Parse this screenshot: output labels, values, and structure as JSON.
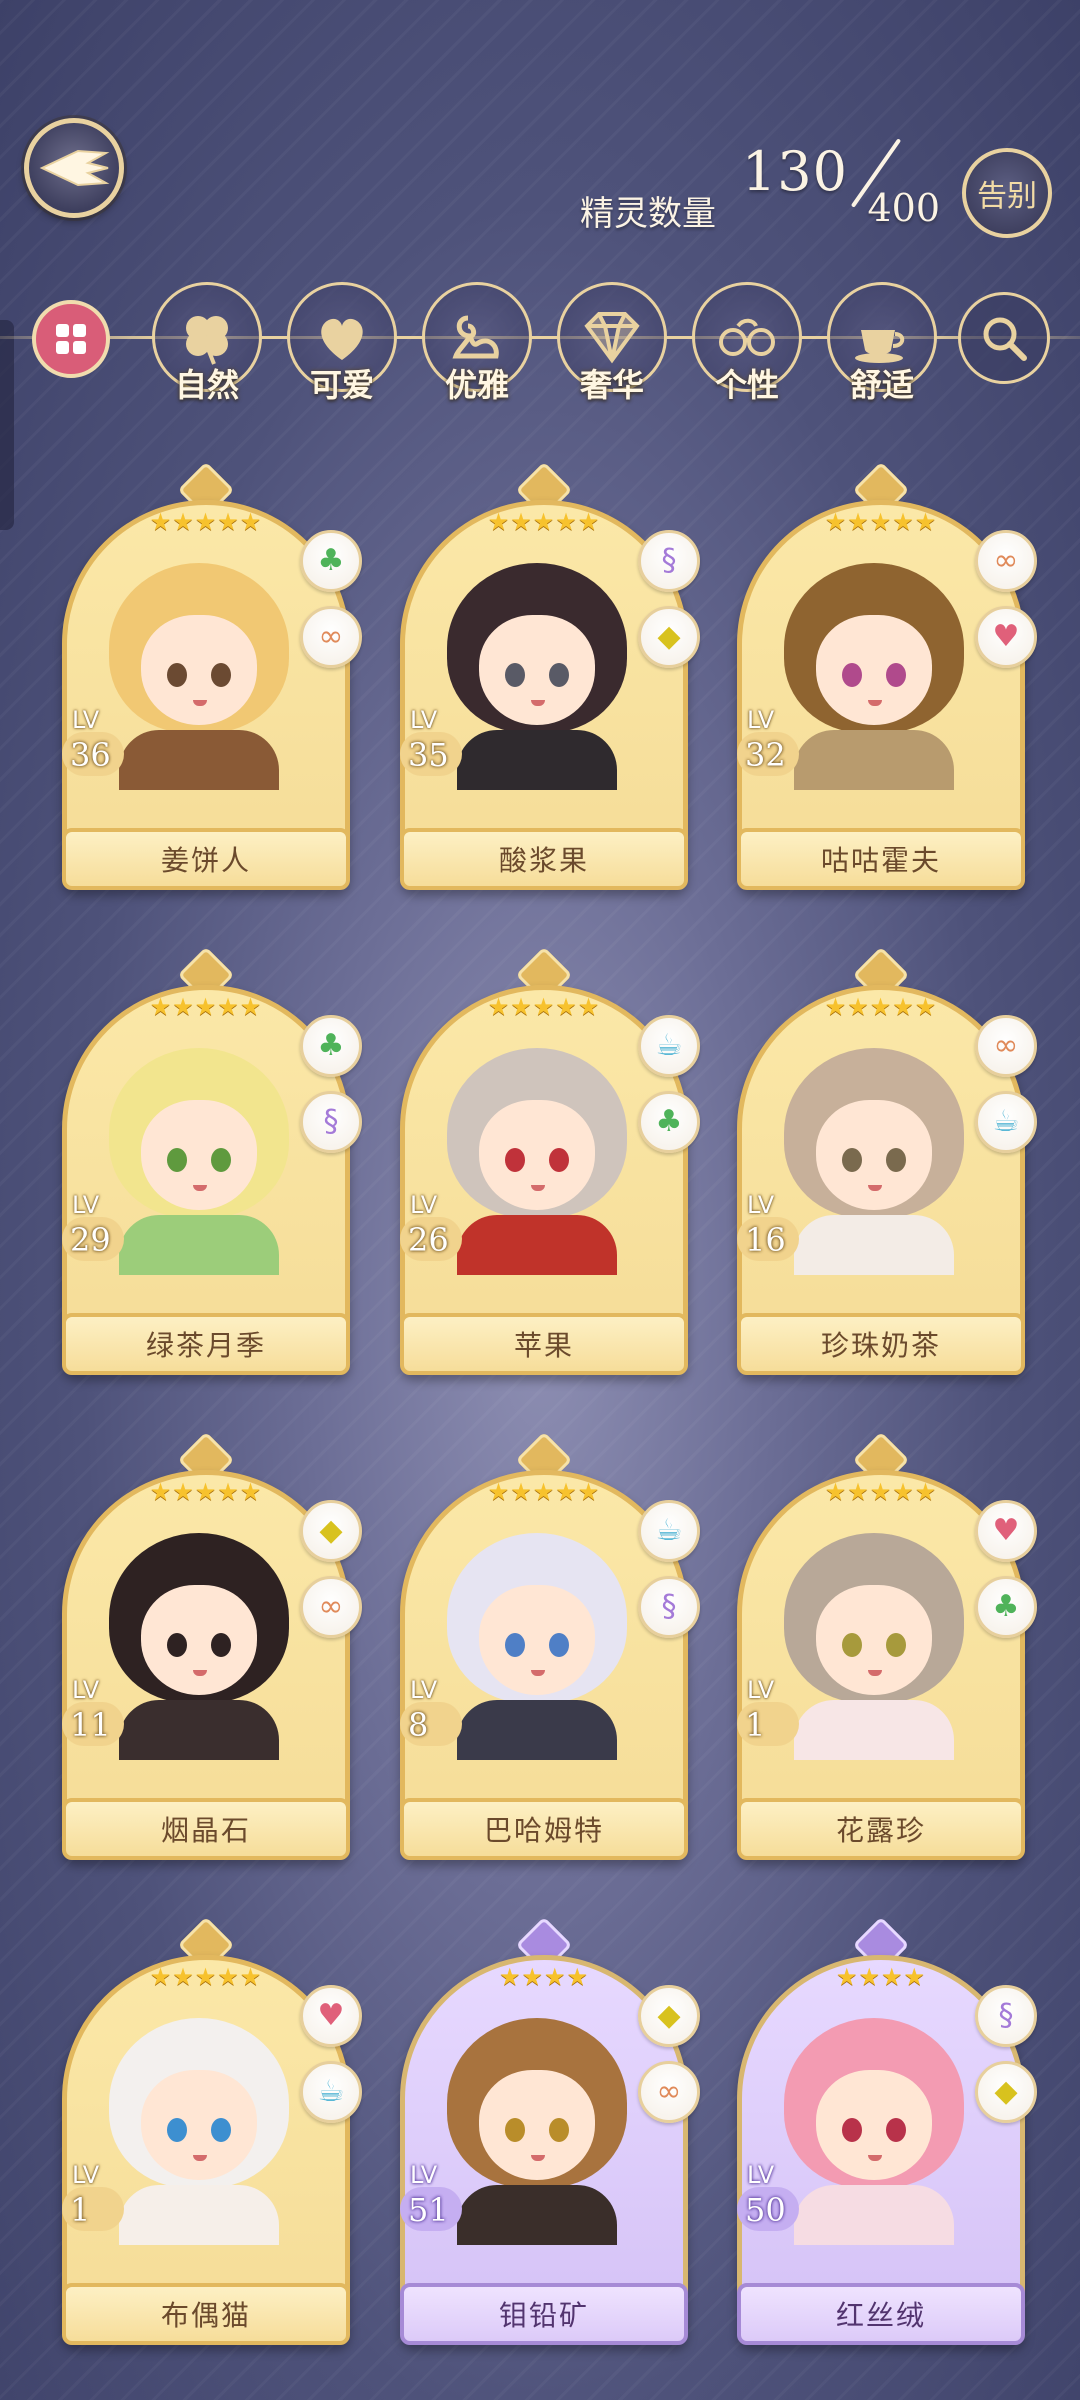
{
  "header": {
    "spirit_count_label": "精灵数量",
    "spirit_count_current": "130",
    "spirit_count_max": "400",
    "farewell_label": "告别"
  },
  "filters": [
    {
      "label": "自然",
      "icon": "clover-icon"
    },
    {
      "label": "可爱",
      "icon": "heart-icon"
    },
    {
      "label": "优雅",
      "icon": "swan-icon"
    },
    {
      "label": "奢华",
      "icon": "diamond-icon"
    },
    {
      "label": "个性",
      "icon": "glasses-icon"
    },
    {
      "label": "舒适",
      "icon": "teacup-icon"
    }
  ],
  "cards": [
    {
      "name": "姜饼人",
      "level_label": "LV",
      "level": "36",
      "stars": "★★★★★",
      "badges": [
        "clover-icon",
        "glasses-icon"
      ],
      "rarity": "gold",
      "hair": "#f1c873",
      "eye": "#6b4a32",
      "outfit": "#8a5a36"
    },
    {
      "name": "酸浆果",
      "level_label": "LV",
      "level": "35",
      "stars": "★★★★★",
      "badges": [
        "swan-icon",
        "diamond-icon"
      ],
      "rarity": "gold",
      "hair": "#3a2a2e",
      "eye": "#595a66",
      "outfit": "#2f2a2e"
    },
    {
      "name": "咕咕霍夫",
      "level_label": "LV",
      "level": "32",
      "stars": "★★★★★",
      "badges": [
        "glasses-icon",
        "heart-icon"
      ],
      "rarity": "gold",
      "hair": "#8f6430",
      "eye": "#b04a8c",
      "outfit": "#b89b6e"
    },
    {
      "name": "绿茶月季",
      "level_label": "LV",
      "level": "29",
      "stars": "★★★★★",
      "badges": [
        "clover-icon",
        "swan-icon"
      ],
      "rarity": "gold",
      "hair": "#f2e58e",
      "eye": "#5f9a3e",
      "outfit": "#9ccd7a"
    },
    {
      "name": "苹果",
      "level_label": "LV",
      "level": "26",
      "stars": "★★★★★",
      "badges": [
        "teacup-icon",
        "clover-icon"
      ],
      "rarity": "gold",
      "hair": "#cfc4bc",
      "eye": "#c0323a",
      "outfit": "#c0332a"
    },
    {
      "name": "珍珠奶茶",
      "level_label": "LV",
      "level": "16",
      "stars": "★★★★★",
      "badges": [
        "glasses-icon",
        "teacup-icon"
      ],
      "rarity": "gold",
      "hair": "#c7b09a",
      "eye": "#7a6a4e",
      "outfit": "#f3ece6"
    },
    {
      "name": "烟晶石",
      "level_label": "LV",
      "level": "11",
      "stars": "★★★★★",
      "badges": [
        "diamond-icon",
        "glasses-icon"
      ],
      "rarity": "gold",
      "hair": "#2e2222",
      "eye": "#2e2222",
      "outfit": "#3a2e2e"
    },
    {
      "name": "巴哈姆特",
      "level_label": "LV",
      "level": "8",
      "stars": "★★★★★",
      "badges": [
        "teacup-icon",
        "swan-icon"
      ],
      "rarity": "gold",
      "hair": "#e6e4f2",
      "eye": "#4f7fc6",
      "outfit": "#3a3a4a"
    },
    {
      "name": "花露珍",
      "level_label": "LV",
      "level": "1",
      "stars": "★★★★★",
      "badges": [
        "heart-icon",
        "clover-icon"
      ],
      "rarity": "gold",
      "hair": "#b8a898",
      "eye": "#a79a3c",
      "outfit": "#f7e6e6"
    },
    {
      "name": "布偶猫",
      "level_label": "LV",
      "level": "1",
      "stars": "★★★★★",
      "badges": [
        "heart-icon",
        "teacup-icon"
      ],
      "rarity": "gold",
      "hair": "#f3f0ee",
      "eye": "#3d8fd0",
      "outfit": "#f6efe9"
    },
    {
      "name": "钼铅矿",
      "level_label": "LV",
      "level": "51",
      "stars": "★★★★",
      "badges": [
        "diamond-icon",
        "glasses-icon"
      ],
      "rarity": "purple",
      "hair": "#a8733e",
      "eye": "#b98d2a",
      "outfit": "#3a2e2a"
    },
    {
      "name": "红丝绒",
      "level_label": "LV",
      "level": "50",
      "stars": "★★★★",
      "badges": [
        "swan-icon",
        "diamond-icon"
      ],
      "rarity": "purple",
      "hair": "#f39bb2",
      "eye": "#b8324a",
      "outfit": "#f6dce3"
    }
  ],
  "colors": {
    "gold_frame": "#e2b85e",
    "purple_frame": "#a68ad6",
    "filter_all": "#d95d78"
  }
}
